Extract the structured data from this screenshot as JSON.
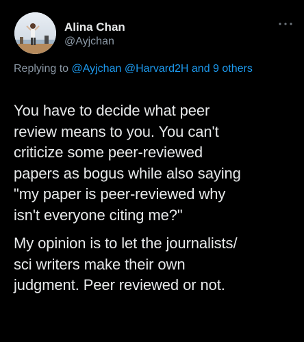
{
  "author": {
    "name": "Alina Chan",
    "handle": "@Ayjchan",
    "avatar_icon": "profile-photo"
  },
  "reply_context": {
    "prefix": "Replying to",
    "mention_1": "@Ayjchan",
    "mention_2": "@Harvard2H",
    "suffix_mention": "and 9 others"
  },
  "tweet": {
    "paragraphs": [
      "You have to decide what peer\nreview means to you. You can't\ncriticize some peer-reviewed\npapers as bogus while also saying\n\"my paper is peer-reviewed why\nisn't everyone citing me?\"",
      "My opinion is to let the journalists/\nsci writers make their own\njudgment. Peer reviewed or not."
    ]
  },
  "colors": {
    "background": "#000000",
    "text": "#e7e9ea",
    "muted": "#8b98a5",
    "link": "#1d9bf0"
  },
  "icons": {
    "more": "more-options-icon"
  }
}
